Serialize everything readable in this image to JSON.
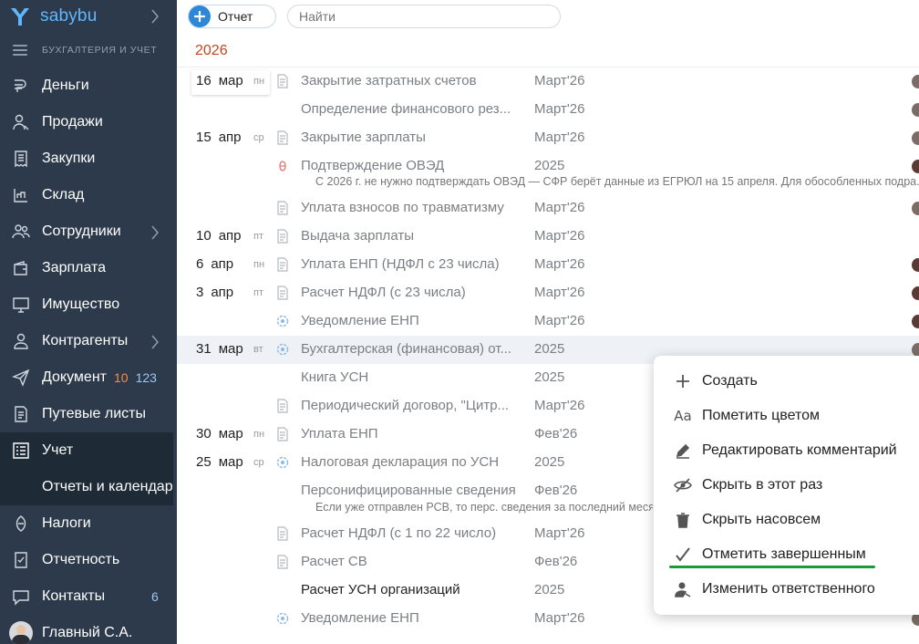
{
  "app": {
    "brand": "sabybu",
    "section": "БУХГАЛТЕРИЯ И УЧЕТ"
  },
  "sidebar": {
    "items": [
      {
        "label": "Деньги"
      },
      {
        "label": "Продажи"
      },
      {
        "label": "Закупки"
      },
      {
        "label": "Склад"
      },
      {
        "label": "Сотрудники"
      },
      {
        "label": "Зарплата"
      },
      {
        "label": "Имущество"
      },
      {
        "label": "Контрагенты"
      },
      {
        "label": "Документ",
        "badge_orange": "10",
        "badge_blue": "123"
      },
      {
        "label": "Путевые листы"
      },
      {
        "label": "Учет"
      },
      {
        "label": "Отчеты и календарь"
      },
      {
        "label": "Налоги"
      },
      {
        "label": "Отчетность"
      },
      {
        "label": "Контакты",
        "badge": "6"
      },
      {
        "label": "Главный С.А."
      }
    ]
  },
  "toolbar": {
    "report_label": "Отчет",
    "search_placeholder": "Найти"
  },
  "year": "2026",
  "rows": [
    {
      "day": "16",
      "month": "мар",
      "dow": "пн",
      "title": "Закрытие затратных счетов",
      "period": "Март'26"
    },
    {
      "title": "Определение финансового рез...",
      "period": "Март'26"
    },
    {
      "day": "15",
      "month": "апр",
      "dow": "ср",
      "title": "Закрытие зарплаты",
      "period": "Март'26"
    },
    {
      "title": "Подтверждение ОВЭД",
      "period": "2025"
    },
    {
      "title": "Уплата взносов по травматизму",
      "period": "Март'26"
    },
    {
      "day": "10",
      "month": "апр",
      "dow": "пт",
      "title": "Выдача зарплаты",
      "period": "Март'26"
    },
    {
      "day": "6",
      "month": "апр",
      "dow": "пн",
      "title": "Уплата ЕНП (НДФЛ с 23 числа)",
      "period": "Март'26"
    },
    {
      "day": "3",
      "month": "апр",
      "dow": "пт",
      "title": "Расчет НДФЛ (с 23 числа)",
      "period": "Март'26"
    },
    {
      "title": "Уведомление ЕНП",
      "period": "Март'26"
    },
    {
      "day": "31",
      "month": "мар",
      "dow": "вт",
      "title": "Бухгалтерская (финансовая) от...",
      "period": "2025"
    },
    {
      "title": "Книга УСН",
      "period": "2025"
    },
    {
      "title": "Периодический договор, \"Цитр...",
      "period": "Март'26"
    },
    {
      "day": "30",
      "month": "мар",
      "dow": "пн",
      "title": "Уплата ЕНП",
      "period": "Фев'26"
    },
    {
      "day": "25",
      "month": "мар",
      "dow": "ср",
      "title": "Налоговая декларация по УСН",
      "period": "2025"
    },
    {
      "title": "Персонифицированные сведения",
      "period": "Фев'26"
    },
    {
      "title": "Расчет НДФЛ (с 1 по 22 число)",
      "period": "Март'26"
    },
    {
      "title": "Расчет СВ",
      "period": "Фев'26"
    },
    {
      "title": "Расчет УСН организаций",
      "period": "2025"
    },
    {
      "title": "Уведомление ЕНП",
      "period": "Март'26"
    }
  ],
  "comments": {
    "oved": "С 2026 г. не нужно подтверждать ОВЭД — СФР берёт данные из ЕГРЮЛ на 15 апреля. Для обособленных подра...",
    "pers": "Если уже отправлен РСВ, то перс. сведения за последний месяц"
  },
  "context_menu": {
    "items": [
      {
        "label": "Создать",
        "icon": "plus-icon"
      },
      {
        "label": "Пометить цветом",
        "icon": "text-color-icon"
      },
      {
        "label": "Редактировать комментарий",
        "icon": "pencil-icon"
      },
      {
        "label": "Скрыть в этот раз",
        "icon": "eye-off-icon"
      },
      {
        "label": "Скрыть насовсем",
        "icon": "trash-icon"
      },
      {
        "label": "Отметить завершенным",
        "icon": "check-icon"
      },
      {
        "label": "Изменить ответственного",
        "icon": "change-user-icon"
      }
    ]
  },
  "colors": {
    "sidebar_bg": "#2c3a4b",
    "sidebar_active": "#1f2a37",
    "accent": "#2d86d6",
    "year": "#c0461b",
    "highlight": "#1a9a3a"
  }
}
